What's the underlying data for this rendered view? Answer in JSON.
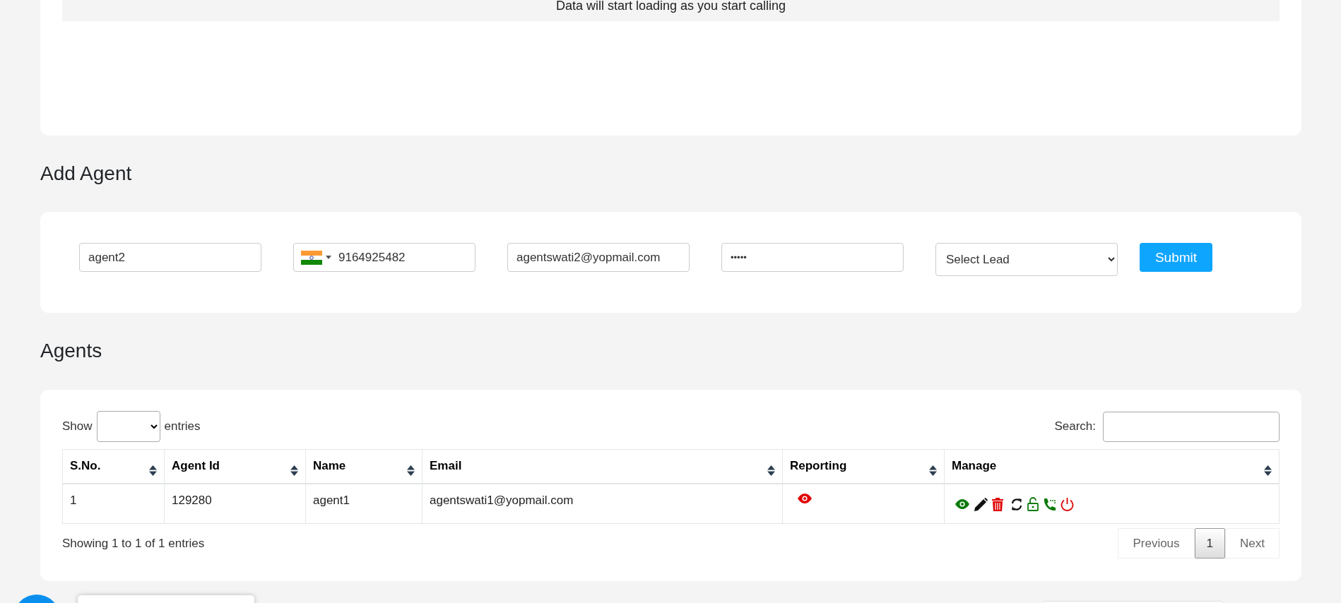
{
  "calls_panel": {
    "message": "Data will start loading as you start calling"
  },
  "add_agent": {
    "heading": "Add Agent",
    "name_field": {
      "value": "agent2"
    },
    "phone_field": {
      "value": "9164925482"
    },
    "email_field": {
      "value": "agentswati2@yopmail.com"
    },
    "password_field": {
      "value": "•••••"
    },
    "lead_select": {
      "value": "Select Lead"
    },
    "submit": "Submit"
  },
  "agents": {
    "heading": "Agents",
    "show_label": "Show",
    "entries_label": "entries",
    "search_label": "Search:",
    "table": {
      "columns": [
        "S.No.",
        "Agent Id",
        "Name",
        "Email",
        "Reporting",
        "Manage"
      ],
      "rows": [
        {
          "cells": [
            "1",
            "129280",
            "agent1",
            "agentswati1@yopmail.com"
          ],
          "reporting": [
            {
              "kind": "view"
            }
          ],
          "actions": [
            {
              "kind": "view"
            },
            {
              "kind": "edit"
            },
            {
              "kind": "delete"
            },
            {
              "kind": "refresh"
            },
            {
              "kind": "unlock"
            },
            {
              "kind": "call"
            },
            {
              "kind": "power"
            }
          ]
        }
      ]
    },
    "info": "Showing 1 to 1 of 1 entries",
    "pagination": {
      "previous": "Previous",
      "pages": [
        {
          "label": "1",
          "selected": true
        }
      ],
      "next": "Next"
    }
  }
}
